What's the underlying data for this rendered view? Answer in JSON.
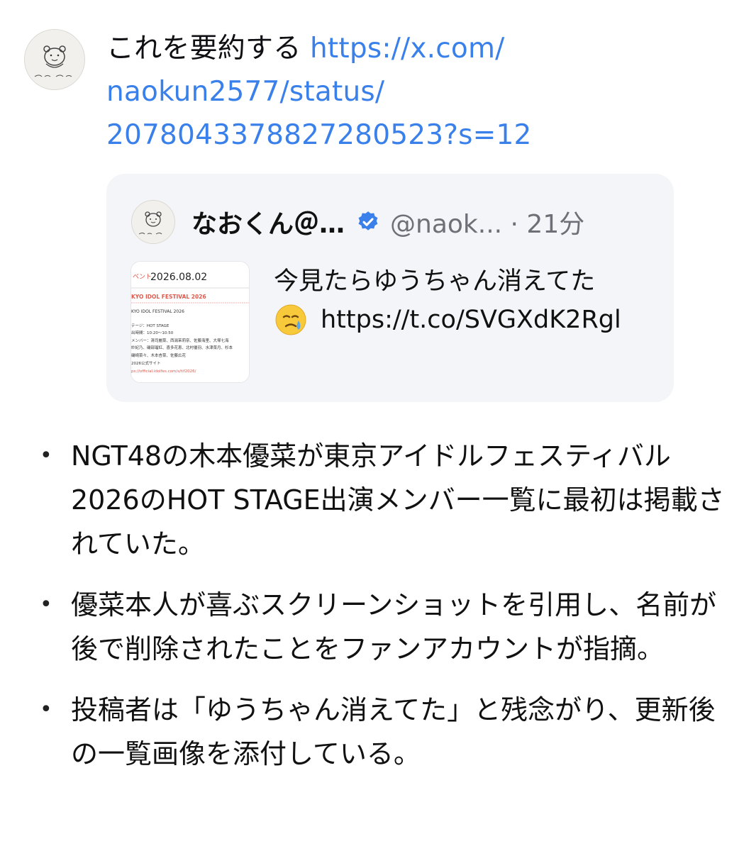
{
  "message": {
    "prompt_lines": [
      "これを要約する ",
      "https://x.com/",
      "naokun2577/status/",
      "2078043378827280523?s=12"
    ]
  },
  "tweet_card": {
    "author_name": "なおくん＠…",
    "handle_time": "@naok... · 21分",
    "text_line1": "今見たらゆうちゃん消えてた",
    "link": "https://t.co/SVGXdK2Rgl",
    "thumbnail": {
      "date": "2026.08.02",
      "lines": [
        "ベント",
        "KYO IDOL FESTIVAL 2026",
        "KYO IDOL FESTIVAL 2026",
        "テージ：HOT STAGE",
        "出時間：10:20〜10:50",
        "メンバー：清司麗菜、西潟茉莉奈、佐藤海里、大塚七海",
        "紗紀乃、磯部瑠紅、喜多花恵、北村優羽、水津菜月、杉本",
        "磯崎菜々、木本杏菜、佐藤広花",
        "2026公式サイト",
        "ps://official.idolfes.com/s/tif2026/"
      ]
    },
    "colors": {
      "verified": "#3a80ea",
      "card_bg": "#f4f5f8"
    },
    "icons": [
      "verified-badge-icon",
      "crying-face-emoji"
    ]
  },
  "summary": {
    "bullet": "•",
    "items": [
      "NGT48の木本優菜が東京アイドルフェスティバル2026のHOT STAGE出演メンバー一覧に最初は掲載されていた。",
      "優菜本人が喜ぶスクリーンショットを引用し、名前が後で削除されたことをファンアカウントが指摘。",
      "投稿者は「ゆうちゃん消えてた」と残念がり、更新後の一覧画像を添付している。"
    ]
  },
  "colors": {
    "link": "#3a80ea",
    "text": "#0f0f14",
    "page_bg": "#ffffff"
  }
}
